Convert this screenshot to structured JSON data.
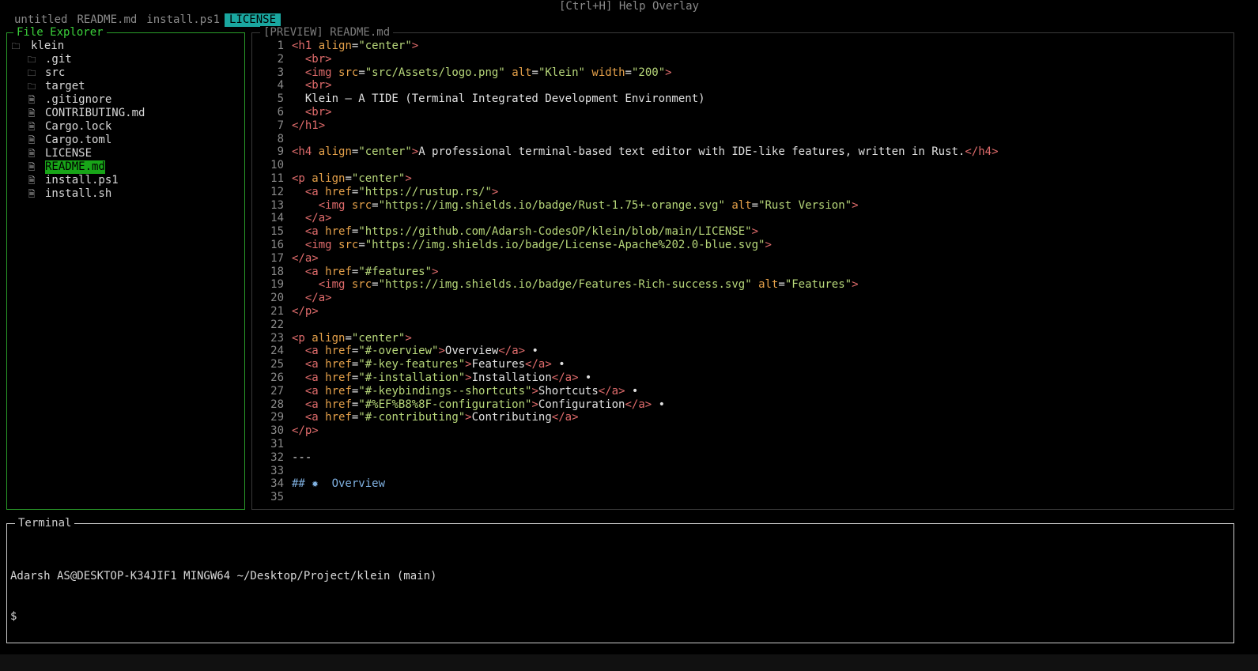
{
  "top": {
    "help_hint": "[Ctrl+H] Help Overlay"
  },
  "tabs": [
    {
      "label": "untitled",
      "active": false
    },
    {
      "label": "README.md",
      "active": false
    },
    {
      "label": "install.ps1",
      "active": false
    },
    {
      "label": "LICENSE",
      "active": true
    }
  ],
  "explorer": {
    "title": "File Explorer",
    "root": "klein",
    "items": [
      {
        "label": ".git",
        "type": "folder"
      },
      {
        "label": "src",
        "type": "folder"
      },
      {
        "label": "target",
        "type": "folder"
      },
      {
        "label": ".gitignore",
        "type": "file"
      },
      {
        "label": "CONTRIBUTING.md",
        "type": "file"
      },
      {
        "label": "Cargo.lock",
        "type": "file"
      },
      {
        "label": "Cargo.toml",
        "type": "file"
      },
      {
        "label": "LICENSE",
        "type": "file"
      },
      {
        "label": "README.md",
        "type": "file",
        "selected": true
      },
      {
        "label": "install.ps1",
        "type": "file"
      },
      {
        "label": "install.sh",
        "type": "file"
      }
    ]
  },
  "preview": {
    "title": "[PREVIEW] README.md",
    "lines": [
      "<h1 align=\"center\">",
      "  <br>",
      "  <img src=\"src/Assets/logo.png\" alt=\"Klein\" width=\"200\">",
      "  <br>",
      "  Klein – A TIDE (Terminal Integrated Development Environment)",
      "  <br>",
      "</h1>",
      "",
      "<h4 align=\"center\">A professional terminal-based text editor with IDE-like features, written in Rust.</h4>",
      "",
      "<p align=\"center\">",
      "  <a href=\"https://rustup.rs/\">",
      "    <img src=\"https://img.shields.io/badge/Rust-1.75+-orange.svg\" alt=\"Rust Version\">",
      "  </a>",
      "  <a href=\"https://github.com/Adarsh-CodesOP/klein/blob/main/LICENSE\">",
      "  <img src=\"https://img.shields.io/badge/License-Apache%202.0-blue.svg\">",
      "</a>",
      "  <a href=\"#features\">",
      "    <img src=\"https://img.shields.io/badge/Features-Rich-success.svg\" alt=\"Features\">",
      "  </a>",
      "</p>",
      "",
      "<p align=\"center\">",
      "  <a href=\"#-overview\">Overview</a> •",
      "  <a href=\"#-key-features\">Features</a> •",
      "  <a href=\"#-installation\">Installation</a> •",
      "  <a href=\"#-keybindings--shortcuts\">Shortcuts</a> •",
      "  <a href=\"#%EF%B8%8F-configuration\">Configuration</a> •",
      "  <a href=\"#-contributing\">Contributing</a>",
      "</p>",
      "",
      "---",
      "",
      "## ✹  Overview",
      ""
    ]
  },
  "terminal": {
    "title": "Terminal",
    "prompt_line": "Adarsh AS@DESKTOP-K34JIF1 MINGW64 ~/Desktop/Project/klein (main)",
    "input_line": "$"
  },
  "colors": {
    "accent_green": "#18a518",
    "tab_active": "#1aa7a0",
    "tag": "#e06c6c",
    "attr": "#e5a14a",
    "string": "#b7d77a"
  }
}
